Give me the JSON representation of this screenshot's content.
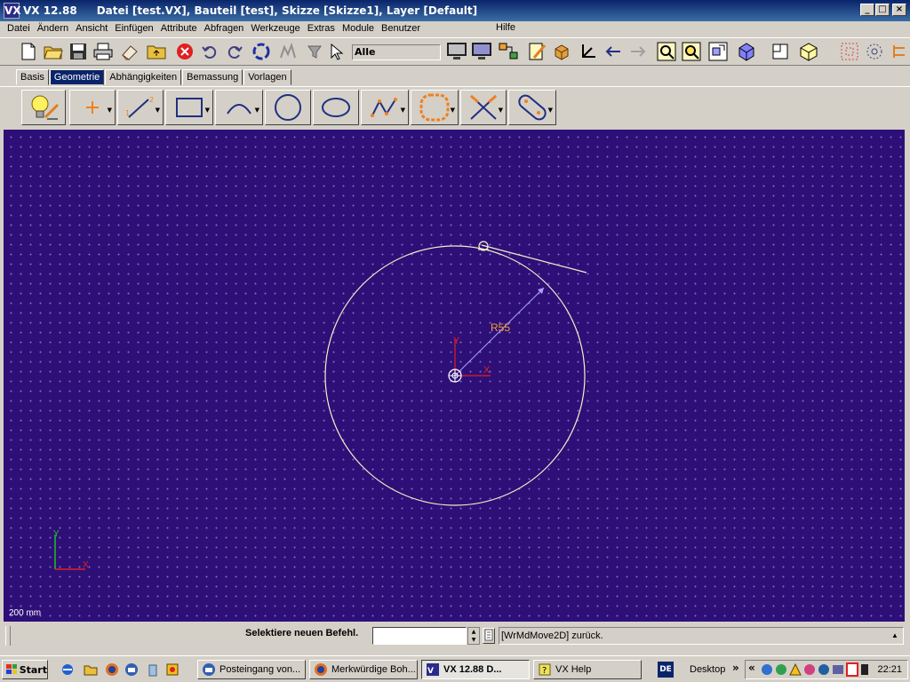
{
  "window": {
    "app_name": "VX  12.88",
    "doc_title": "Datei [test.VX], Bauteil [test], Skizze [Skizze1], Layer [Default]",
    "logo": "VX",
    "minimize": "_",
    "maximize": "□",
    "close": "×"
  },
  "menu": {
    "items": [
      "Datei",
      "Ändern",
      "Ansicht",
      "Einfügen",
      "Attribute",
      "Abfragen",
      "Werkzeuge",
      "Extras",
      "Module",
      "Benutzer"
    ],
    "help": "Hilfe"
  },
  "toolbar": {
    "filter_value": "Alle"
  },
  "tabs": [
    {
      "label": "Basis",
      "active": false
    },
    {
      "label": "Geometrie",
      "active": true
    },
    {
      "label": "Abhängigkeiten",
      "active": false
    },
    {
      "label": "Bemassung",
      "active": false
    },
    {
      "label": "Vorlagen",
      "active": false
    }
  ],
  "canvas": {
    "scale_label": "200 mm",
    "dimension_label": "R55",
    "axis_x": "X",
    "axis_y": "Y",
    "colors": {
      "background": "#2e0f78",
      "geometry": "#f5f0c8",
      "axis_x": "#e02020",
      "axis_y": "#20c020",
      "dimension": "#f0a030"
    }
  },
  "status": {
    "prompt": "Selektiere neuen Befehl.",
    "command_value": "",
    "message": "[WrMdMove2D] zurück."
  },
  "taskbar": {
    "start": "Start",
    "tasks": [
      {
        "label": "Posteingang von...",
        "active": false
      },
      {
        "label": "Merkwürdige Boh...",
        "active": false
      },
      {
        "label": "VX  12.88     D...",
        "active": true
      },
      {
        "label": "VX Help",
        "active": false
      }
    ],
    "language": "DE",
    "desktop": "Desktop",
    "chevron": "»",
    "tray_chevron": "«",
    "clock": "22:21"
  }
}
